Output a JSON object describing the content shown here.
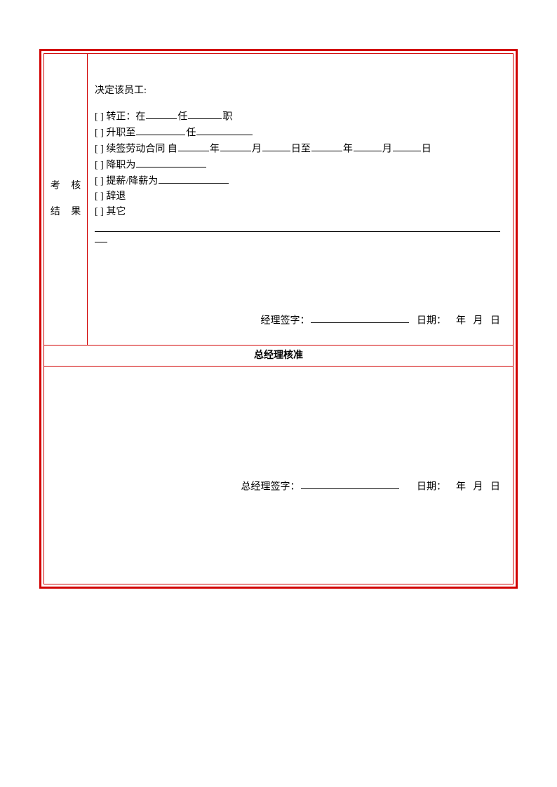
{
  "leftLabel": {
    "line1": "考 核",
    "line2": "结 果"
  },
  "decision": {
    "intro": "决定该员工:",
    "opt1_a": "[ ] 转正：在",
    "opt1_b": "任",
    "opt1_c": "职",
    "opt2_a": "[ ] 升职至",
    "opt2_b": "任",
    "opt3_a": "[ ] 续签劳动合同   自",
    "opt3_y1": "年",
    "opt3_m1": "月",
    "opt3_d1": "日至",
    "opt3_y2": "年",
    "opt3_m2": "月",
    "opt3_d2": "日",
    "opt4": "[ ] 降职为",
    "opt5": "[ ] 提薪/降薪为",
    "opt6": "[ ] 辞退",
    "opt7": "[ ] 其它"
  },
  "sig1": {
    "label": "经理签字：",
    "date_label": "日期：",
    "y": "年",
    "m": "月",
    "d": "日"
  },
  "gm": {
    "header": "总经理核准",
    "sig_label": "总经理签字：",
    "date_label": "日期：",
    "y": "年",
    "m": "月",
    "d": "日"
  }
}
